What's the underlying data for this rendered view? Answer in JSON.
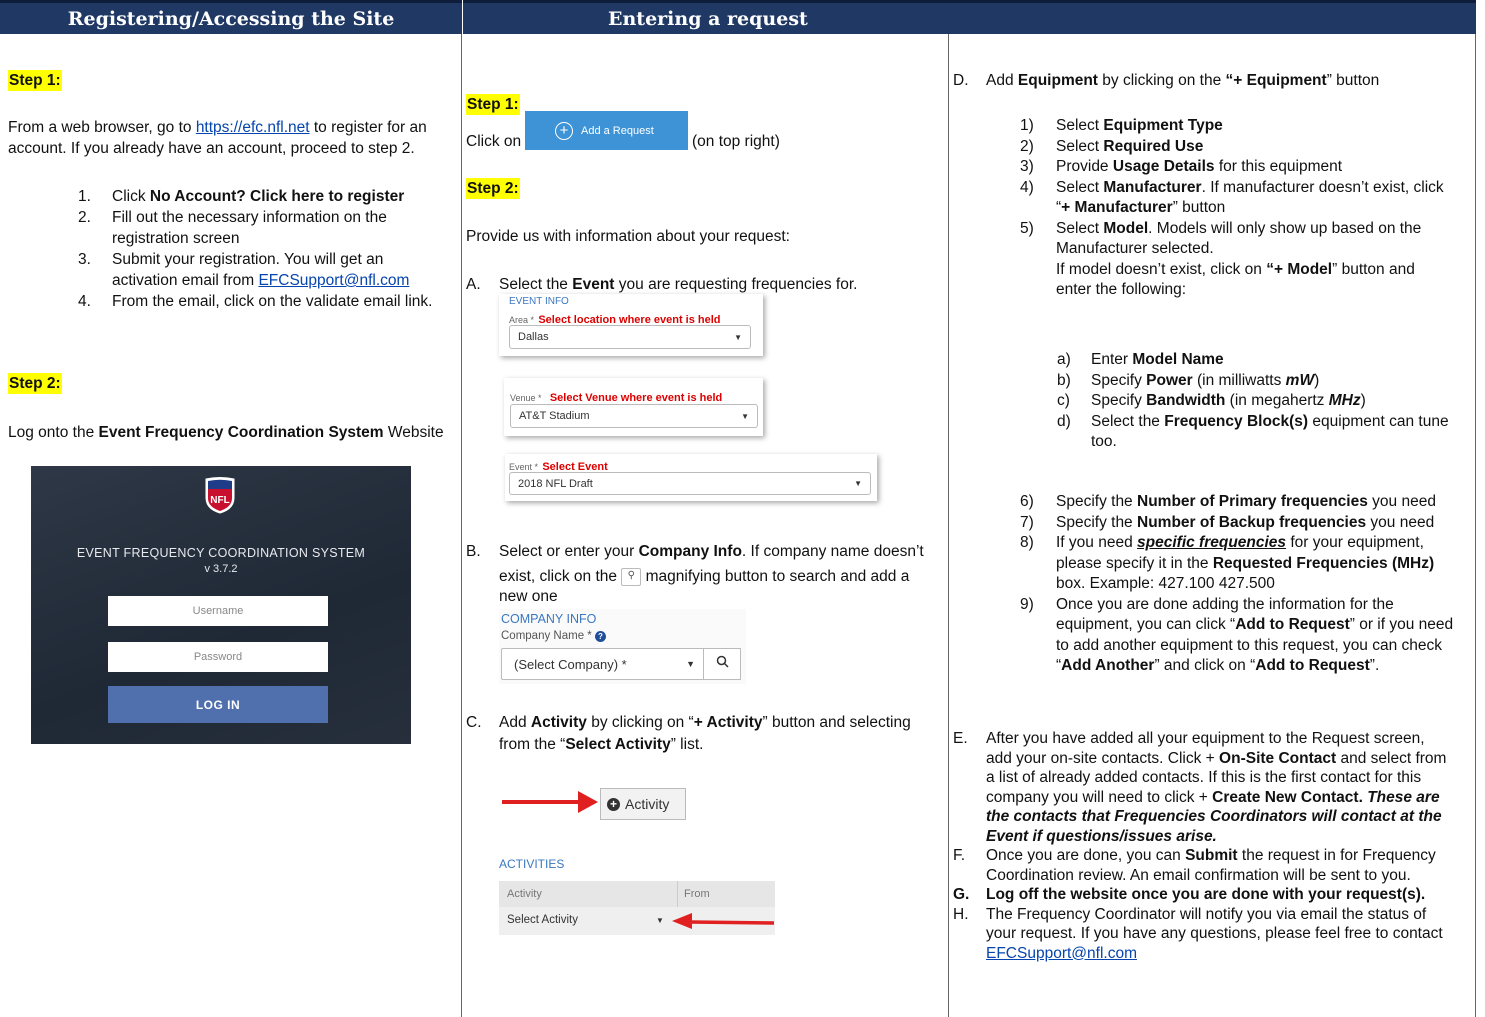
{
  "headers": {
    "left": "Registering/Accessing the Site",
    "right": "Entering a request"
  },
  "col1": {
    "step1": "Step 1:",
    "intro_pre": "From a web browser, go to ",
    "intro_link": "https://efc.nfl.net",
    "intro_post1": " to register for an",
    "intro_post2": "account.  If you already have an account, proceed to step 2.",
    "items": [
      {
        "num": "1.",
        "pre": "Click ",
        "bold": "No Account? Click here to register",
        "post": ""
      },
      {
        "num": "2.",
        "pre": " Fill out the necessary information on the",
        "post2": "registration screen"
      },
      {
        "num": "3.",
        "pre": "Submit your registration.  You will get an",
        "pre2": "activation email from ",
        "link": "EFCSupport@nfl.com"
      },
      {
        "num": "4.",
        "pre": "From the email, click on the validate email link."
      }
    ],
    "step2": "Step 2:",
    "logon_pre": "Log onto the ",
    "logon_bold": "Event Frequency Coordination System",
    "logon_post": " Website",
    "login": {
      "logo": "NFL",
      "title": "EVENT FREQUENCY COORDINATION SYSTEM",
      "version": "v 3.7.2",
      "username_placeholder": "Username",
      "password_placeholder": "Password",
      "button": "LOG IN"
    }
  },
  "col2": {
    "step1": "Step 1:",
    "click_on": "Click on",
    "add_request_btn": "Add a Request",
    "top_right": "(on top right)",
    "step2": "Step 2:",
    "provide": "Provide us with information about your request:",
    "A_letter": "A.",
    "A_pre": "Select the ",
    "A_bold": "Event",
    "A_post": " you are requesting frequencies for.",
    "event_info": {
      "header": "EVENT INFO",
      "area_label": "Area *",
      "area_hint": "Select location where event is held",
      "area_value": "Dallas",
      "venue_label": "Venue *",
      "venue_hint": "Select Venue where event is held",
      "venue_value": "AT&T Stadium",
      "event_label": "Event *",
      "event_hint": "Select Event",
      "event_value": "2018 NFL Draft"
    },
    "B_letter": "B.",
    "B_pre": "Select or enter your ",
    "B_bold": "Company Info",
    "B_post": ".  If company name doesn’t",
    "B_line2a": "exist, click on the ",
    "B_line2b": " magnifying button to search and add a",
    "B_line3": "new one",
    "company": {
      "header": "COMPANY INFO",
      "label": "Company Name *",
      "select": "(Select Company) *"
    },
    "C_letter": "C.",
    "C_pre": "Add ",
    "C_bold": "Activity",
    "C_mid": " by clicking on “",
    "C_bold2": "+ Activity",
    "C_post": "” button and selecting",
    "C_line2a": "from the “",
    "C_line2b": "Select Activity",
    "C_line2c": "” list.",
    "activity_btn": "Activity",
    "activities": {
      "header": "ACTIVITIES",
      "col1": "Activity",
      "col2": "From",
      "select": "Select Activity"
    }
  },
  "col3": {
    "D_letter": "D.",
    "D_pre": "Add ",
    "D_bold": "Equipment",
    "D_mid": " by clicking on the ",
    "D_bold2": "“+ Equipment",
    "D_post": "” button",
    "items": [
      {
        "n": "1)",
        "pre": "Select ",
        "bold": "Equipment Type"
      },
      {
        "n": "2)",
        "pre": "Select ",
        "bold": "Required Use"
      },
      {
        "n": "3)",
        "pre": "Provide ",
        "bold": "Usage Details",
        "post": " for this equipment"
      },
      {
        "n": "4)",
        "pre": "Select ",
        "bold": "Manufacturer",
        "post": ".  If manufacturer doesn’t exist, click",
        "line2a": "“",
        "line2b": "+ Manufacturer",
        "line2c": "” button"
      },
      {
        "n": "5)",
        "pre": "Select ",
        "bold": "Model",
        "post": ".  Models will only show up based on the",
        "line2": "Manufacturer selected.",
        "line3a": "If model doesn’t exist, click on ",
        "line3b": "“+ Model",
        "line3c": "” button and",
        "line4": "enter the following:"
      }
    ],
    "sub": [
      {
        "n": "a)",
        "pre": "Enter ",
        "bold": "Model Name"
      },
      {
        "n": "b)",
        "pre": "Specify ",
        "bold": "Power",
        "post": " (in milliwatts ",
        "em": "mW",
        "end": ")"
      },
      {
        "n": "c)",
        "pre": "Specify ",
        "bold": "Bandwidth",
        "post": " (in megahertz ",
        "em": "MHz",
        "end": ")"
      },
      {
        "n": "d)",
        "pre": "Select the ",
        "bold": "Frequency Block(s)",
        "post": " equipment can tune",
        "line2": "too."
      }
    ],
    "items2": [
      {
        "n": "6)",
        "pre": "Specify the ",
        "bold": "Number of Primary frequencies",
        "post": " you need"
      },
      {
        "n": "7)",
        "pre": "Specify the ",
        "bold": "Number of Backup frequencies",
        "post": " you need"
      },
      {
        "n": "8)",
        "pre": "If you need ",
        "em": "specific frequencies",
        "post": " for your equipment,",
        "line2a": "please specify it in the ",
        "line2b": "Requested Frequencies (MHz)",
        "line3": "box.  Example: 427.100 427.500"
      },
      {
        "n": "9)",
        "l1": "Once you are done adding the information for the",
        "l2a": "equipment, you can click “",
        "l2b": "Add to Request",
        "l2c": "” or if you need",
        "l3": "to add another equipment to this request, you can check",
        "l4a": "“",
        "l4b": "Add Another",
        "l4c": "” and click on “",
        "l4d": "Add to Request",
        "l4e": "”."
      }
    ],
    "E_letter": "E.",
    "E_l1": "After you have added all your equipment to the Request screen,",
    "E_l2a": "add your on-site contacts.  Click + ",
    "E_l2b": "On-Site Contact",
    "E_l2c": " and select from",
    "E_l3": "a list of already added contacts.  If this is the first contact for this",
    "E_l4a": "company you will need to click + ",
    "E_l4b": "Create New Contact.",
    "E_l4c": " These are",
    "E_l5": "the contacts that Frequencies Coordinators will contact at the",
    "E_l6": "Event if questions/issues arise.",
    "F_letter": "F.",
    "F_l1a": "Once you are done, you can ",
    "F_l1b": "Submit",
    "F_l1c": " the request in for Frequency",
    "F_l2": "Coordination review.  An email confirmation will be sent to you.",
    "G_letter": "G.",
    "G_text": "Log off the website once you are done with your request(s).",
    "H_letter": "H.",
    "H_l1": "The Frequency Coordinator will notify you via email the status of",
    "H_l2": "your request.  If you have any questions, please feel free to contact",
    "H_link": "EFCSupport@nfl.com"
  }
}
